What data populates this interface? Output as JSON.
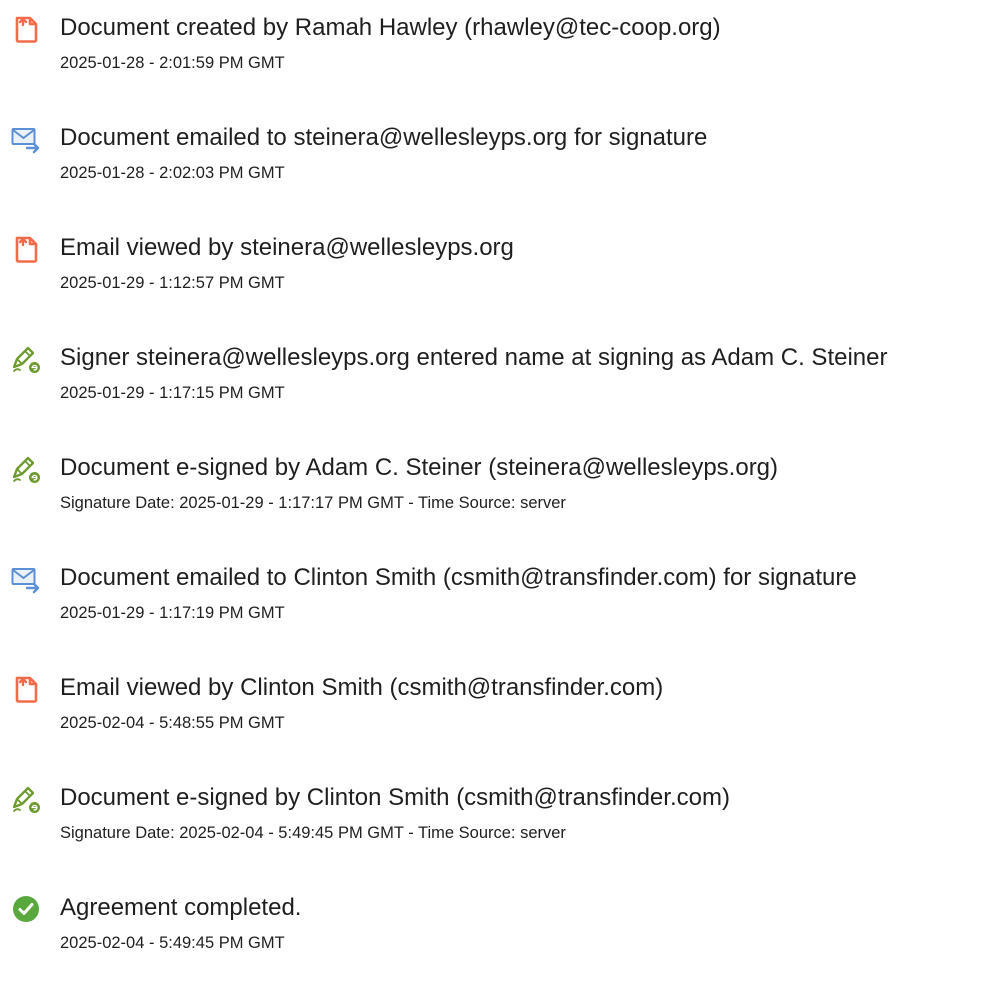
{
  "events": [
    {
      "icon": "document-icon",
      "title": "Document created by Ramah Hawley (rhawley@tec-coop.org)",
      "detail": "2025-01-28 - 2:01:59 PM GMT"
    },
    {
      "icon": "email-sent-icon",
      "title": "Document emailed to steinera@wellesleyps.org for signature",
      "detail": "2025-01-28 - 2:02:03 PM GMT"
    },
    {
      "icon": "document-icon",
      "title": "Email viewed by steinera@wellesleyps.org",
      "detail": "2025-01-29 - 1:12:57 PM GMT"
    },
    {
      "icon": "e-sign-pen-icon",
      "title": "Signer steinera@wellesleyps.org entered name at signing as Adam C. Steiner",
      "detail": "2025-01-29 - 1:17:15 PM GMT"
    },
    {
      "icon": "e-sign-pen-icon",
      "title": "Document e-signed by Adam C. Steiner (steinera@wellesleyps.org)",
      "detail": "Signature Date: 2025-01-29 - 1:17:17 PM GMT - Time Source: server"
    },
    {
      "icon": "email-sent-icon",
      "title": "Document emailed to Clinton Smith (csmith@transfinder.com) for signature",
      "detail": "2025-01-29 - 1:17:19 PM GMT"
    },
    {
      "icon": "document-icon",
      "title": "Email viewed by Clinton Smith (csmith@transfinder.com)",
      "detail": "2025-02-04 - 5:48:55 PM GMT"
    },
    {
      "icon": "e-sign-pen-icon",
      "title": "Document e-signed by Clinton Smith (csmith@transfinder.com)",
      "detail": "Signature Date: 2025-02-04 - 5:49:45 PM GMT - Time Source: server"
    },
    {
      "icon": "check-circle-icon",
      "title": "Agreement completed.",
      "detail": "2025-02-04 - 5:49:45 PM GMT"
    }
  ],
  "colors": {
    "document_icon": "#f26b4a",
    "email_icon": "#5b8fd6",
    "pen_icon": "#6d9a2f",
    "check_icon": "#59a83e"
  }
}
